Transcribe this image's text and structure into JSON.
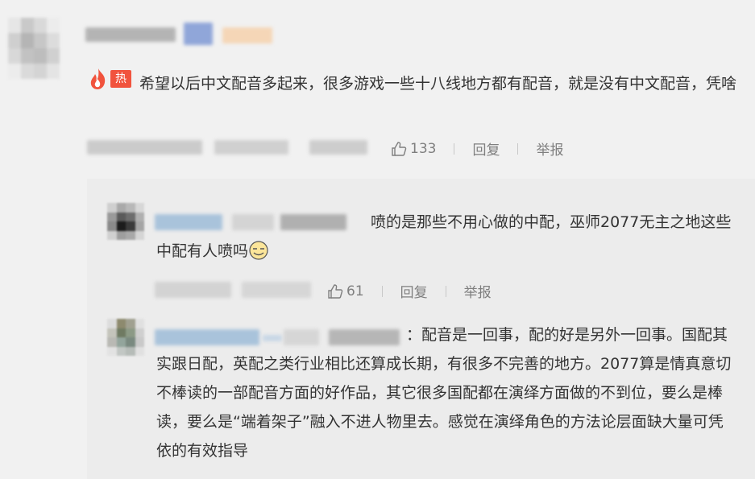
{
  "main_comment": {
    "hot_badge": "热",
    "text": "希望以后中文配音多起来，很多游戏一些十八线地方都有配音，就是没有中文配音，凭啥",
    "likes": "133",
    "reply_label": "回复",
    "report_label": "举报"
  },
  "replies": [
    {
      "text": "喷的是那些不用心做的中配，巫师2077无主之地这些中配有人喷吗",
      "likes": "61",
      "reply_label": "回复",
      "report_label": "举报"
    },
    {
      "text": "：配音是一回事，配的好是另外一回事。国配其实跟日配，英配之类行业相比还算成长期，有很多不完善的地方。2077算是情真意切不棒读的一部配音方面的好作品，其它很多国配都在演绎方面做的不到位，要么是棒读，要么是“端着架子”融入不进人物里去。感觉在演绎角色的方法论层面缺大量可凭依的有效指导"
    }
  ],
  "colors": {
    "hot_badge": "#f1533d",
    "text": "#333333",
    "meta": "#7f7f7f",
    "background": "#f1f1f1",
    "reply_panel": "#ececec"
  },
  "icons": [
    "fire-icon",
    "thumb-up-icon",
    "emoji-icon"
  ]
}
